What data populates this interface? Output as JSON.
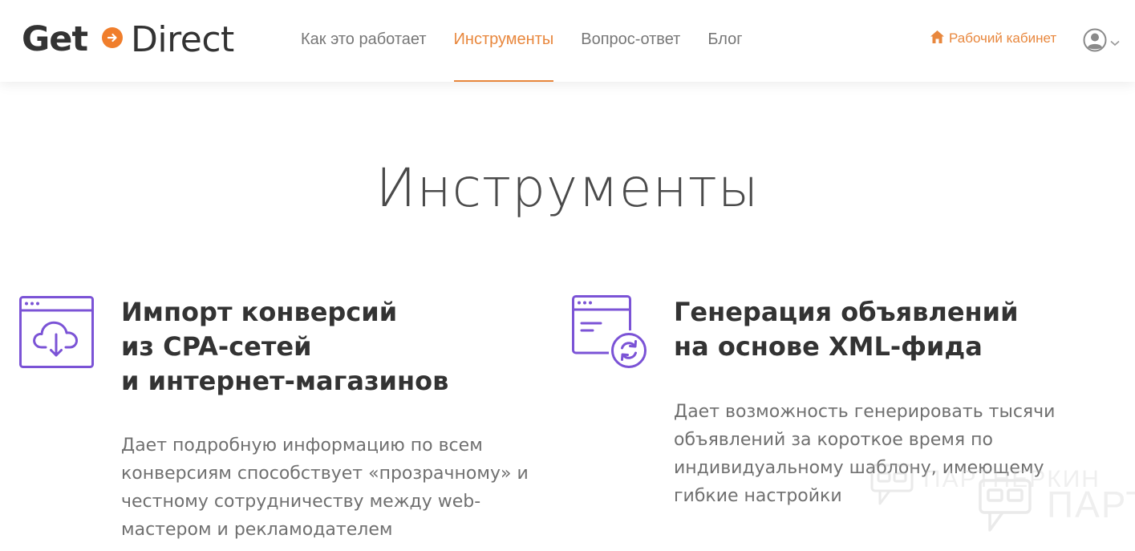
{
  "header": {
    "logo": {
      "part1": "Get",
      "part2": "Direct"
    },
    "nav": [
      {
        "label": "Как это работает",
        "active": false
      },
      {
        "label": "Инструменты",
        "active": true
      },
      {
        "label": "Вопрос-ответ",
        "active": false
      },
      {
        "label": "Блог",
        "active": false
      }
    ],
    "cabinet_label": "Рабочий кабинет",
    "cabinet_icon": "home-icon",
    "user_icon": "user-avatar-icon"
  },
  "main": {
    "title": "Инструменты",
    "features": [
      {
        "icon": "cloud-download-window-icon",
        "title_lines": [
          "Импорт конверсий",
          "из CPA-сетей",
          "и интернет-магазинов"
        ],
        "desc_lines": [
          "Дает подробную информацию по всем",
          "конверсиям способствует «прозрачному» и",
          "честному сотрудничеству между web-",
          "мастером и рекламодателем"
        ]
      },
      {
        "icon": "refresh-window-icon",
        "title_lines": [
          "Генерация объявлений",
          "на основе XML-фида"
        ],
        "desc_lines": [
          "Дает возможность генерировать тысячи",
          "объявлений за короткое время по",
          "индивидуальному шаблону, имеющему",
          "гибкие настройки"
        ]
      }
    ]
  },
  "watermark": {
    "line1": "ПАРТНЕРКИН",
    "line2": "ПАРТ"
  },
  "colors": {
    "accent": "#e8873d",
    "icon_purple": "#7b53d6",
    "text_dark": "#333333",
    "text_gray": "#707070",
    "nav_gray": "#777777"
  }
}
